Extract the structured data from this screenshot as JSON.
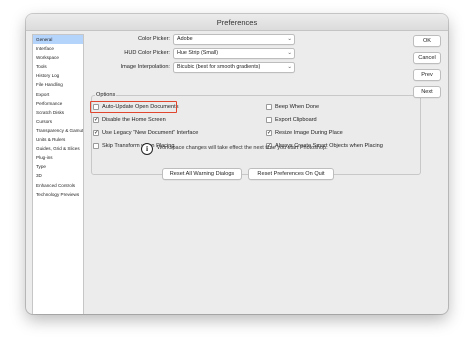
{
  "window": {
    "title": "Preferences"
  },
  "sidebar": {
    "items": [
      {
        "label": "General",
        "selected": true
      },
      {
        "label": "Interface"
      },
      {
        "label": "Workspace"
      },
      {
        "label": "Tools"
      },
      {
        "label": "History Log"
      },
      {
        "label": "File Handling"
      },
      {
        "label": "Export"
      },
      {
        "label": "Performance"
      },
      {
        "label": "Scratch Disks"
      },
      {
        "label": "Cursors"
      },
      {
        "label": "Transparency & Gamut"
      },
      {
        "label": "Units & Rulers"
      },
      {
        "label": "Guides, Grid & Slices"
      },
      {
        "label": "Plug-ins"
      },
      {
        "label": "Type"
      },
      {
        "label": "3D"
      },
      {
        "label": "Enhanced Controls"
      },
      {
        "label": "Technology Previews"
      }
    ]
  },
  "fields": {
    "color_picker": {
      "label": "Color Picker:",
      "value": "Adobe"
    },
    "hud_color_picker": {
      "label": "HUD Color Picker:",
      "value": "Hue Strip (Small)"
    },
    "image_interpolation": {
      "label": "Image Interpolation:",
      "value": "Bicubic (best for smooth gradients)"
    }
  },
  "options": {
    "title": "Options",
    "auto_update": {
      "label": "Auto-Update Open Documents",
      "checked": false
    },
    "beep_when_done": {
      "label": "Beep When Done",
      "checked": false
    },
    "disable_home_screen": {
      "label": "Disable the Home Screen",
      "checked": true
    },
    "export_clipboard": {
      "label": "Export Clipboard",
      "checked": false
    },
    "legacy_new_document": {
      "label": "Use Legacy “New Document” Interface",
      "checked": true
    },
    "resize_image_placing": {
      "label": "Resize Image During Place",
      "checked": true
    },
    "skip_transform": {
      "label": "Skip Transform when Placing",
      "checked": false
    },
    "always_smart_objects": {
      "label": "Always Create Smart Objects when Placing",
      "checked": true
    }
  },
  "info": {
    "text": "Workspace changes will take effect the next time you start Photoshop."
  },
  "buttons": {
    "ok": "OK",
    "cancel": "Cancel",
    "prev": "Prev",
    "next": "Next",
    "reset_warnings": "Reset All Warning Dialogs",
    "reset_preferences": "Reset Preferences On Quit"
  },
  "colors": {
    "highlight": "#e0462e",
    "selection": "#b5d4fb"
  }
}
